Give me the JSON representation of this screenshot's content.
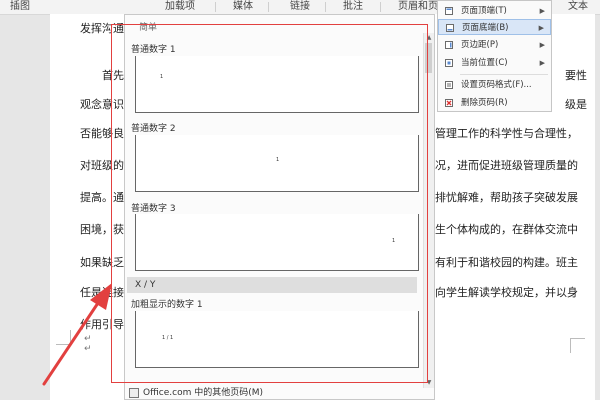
{
  "ribbon": {
    "items": [
      "插图",
      "加载项",
      "媒体",
      "链接",
      "批注",
      "页眉和页",
      "文本"
    ]
  },
  "document": {
    "lines": [
      "发挥沟通",
      "首先",
      "观念意识",
      "否能够良",
      "对班级的",
      "提高。通过",
      "困境，获得",
      "如果缺乏",
      "任是连接",
      "作用引导"
    ],
    "right_lines": [
      "要性",
      "级是",
      "管理工作的科学性与合理性，",
      "况，进而促进班级管理质量的",
      "排忧解难，帮助孩子突破发展",
      "生个体构成的，在群体交流中",
      "有利于和谐校园的构建。班主",
      "向学生解读学校规定，并以身"
    ],
    "para_marks": [
      "↵",
      "↵"
    ]
  },
  "gallery": {
    "header": "简单",
    "items": [
      {
        "label": "普通数字 1",
        "sample": "1"
      },
      {
        "label": "普通数字 2",
        "sample": "1"
      },
      {
        "label": "普通数字 3",
        "sample": "1"
      }
    ],
    "category": "X / Y",
    "bold_item": {
      "label": "加粗显示的数字 1",
      "sample": "1 / 1"
    },
    "footer": "Office.com 中的其他页码(M)"
  },
  "menu": {
    "items": [
      {
        "label": "页面顶端(T)",
        "icon": "page-top-icon",
        "arrow": true,
        "highlighted": false,
        "disabled": false
      },
      {
        "label": "页面底端(B)",
        "icon": "page-bottom-icon",
        "arrow": true,
        "highlighted": true,
        "disabled": false
      },
      {
        "label": "页边距(P)",
        "icon": "page-margin-icon",
        "arrow": true,
        "highlighted": false,
        "disabled": false
      },
      {
        "label": "当前位置(C)",
        "icon": "current-position-icon",
        "arrow": true,
        "highlighted": false,
        "disabled": false
      },
      {
        "label": "设置页码格式(F)...",
        "icon": "format-icon",
        "arrow": false,
        "highlighted": false,
        "disabled": false
      },
      {
        "label": "删除页码(R)",
        "icon": "delete-icon",
        "arrow": false,
        "highlighted": false,
        "disabled": false
      }
    ]
  },
  "colors": {
    "annotation": "#e2403f",
    "highlight": "#d9e6f7"
  }
}
